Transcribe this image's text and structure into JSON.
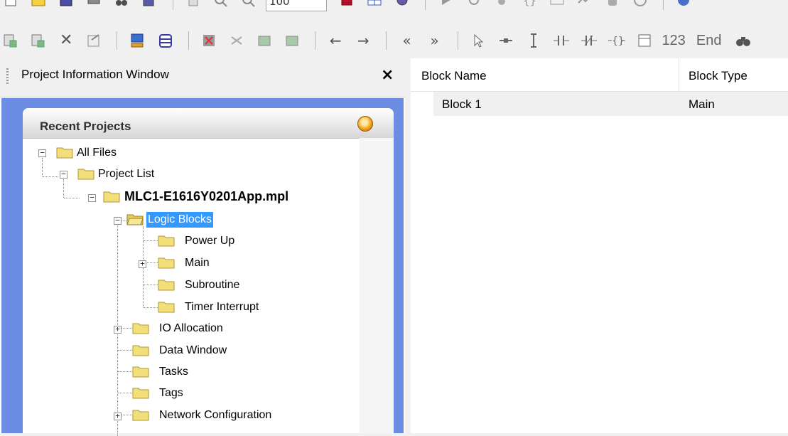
{
  "toolbar_top": {
    "zoom_value": "100",
    "buttons": [
      "new-icon",
      "open-icon",
      "save-icon",
      "print-icon",
      "cut-icon",
      "paste-icon",
      "page-icon",
      "zoom-in-icon",
      "zoom-out-icon",
      "stop-icon",
      "grid-icon",
      "settings-icon",
      "run-icon",
      "step-icon",
      "breakpoint-icon",
      "watch-icon",
      "trend-icon",
      "hand-icon",
      "monitor-icon",
      "globe-icon"
    ]
  },
  "toolbar_bottom": {
    "buttons": [
      "insert-rung-icon",
      "append-rung-icon",
      "delete-icon",
      "properties-icon",
      "connect-icon",
      "database-icon",
      "delete-branch-icon",
      "split-icon",
      "add-block-icon",
      "remove-block-icon",
      "arrow-left-icon",
      "arrow-right-icon",
      "double-left-icon",
      "double-right-icon",
      "pointer-icon",
      "wire-icon",
      "vertical-wire-icon",
      "contact-no-icon",
      "contact-nc-icon",
      "coil-icon",
      "function-block-icon"
    ],
    "number_label": "123",
    "end_label": "End",
    "find_icon": "binoculars-icon"
  },
  "project_window": {
    "title": "Project Information Window",
    "close_glyph": "×"
  },
  "recent_projects": {
    "title": "Recent Projects",
    "tree": {
      "all_files": "All Files",
      "project_list": "Project List",
      "project_file": "MLC1-E1616Y0201App.mpl",
      "logic_blocks": "Logic Blocks",
      "power_up": "Power Up",
      "main": "Main",
      "subroutine": "Subroutine",
      "timer_interrupt": "Timer Interrupt",
      "io_allocation": "IO Allocation",
      "data_window": "Data Window",
      "tasks": "Tasks",
      "tags": "Tags",
      "network_configuration": "Network Configuration"
    },
    "colors": {
      "background": "#6b8de4",
      "selection": "#3399ff",
      "folder": "#f2df7a"
    }
  },
  "block_grid": {
    "headers": {
      "block_name": "Block Name",
      "block_type": "Block Type"
    },
    "rows": [
      {
        "name": "Block 1",
        "type": "Main"
      }
    ]
  }
}
